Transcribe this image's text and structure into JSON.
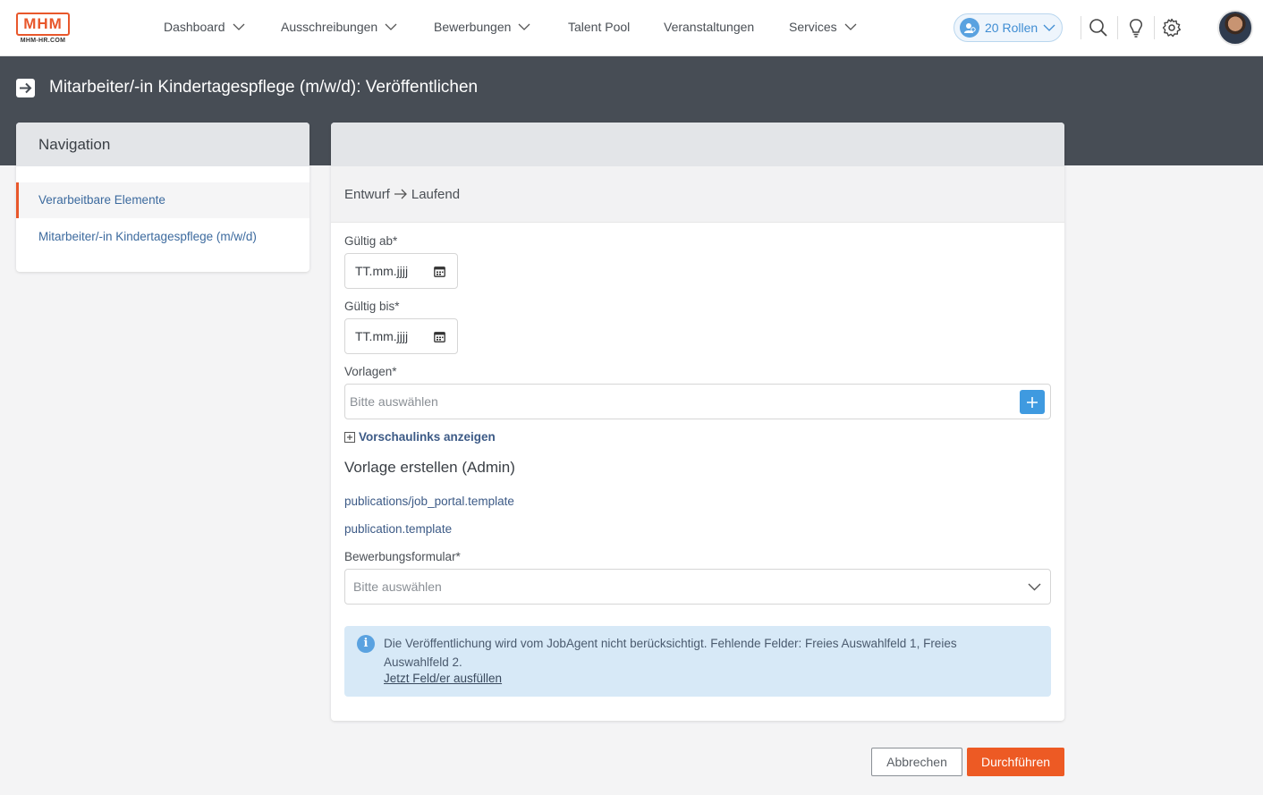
{
  "logo": {
    "text": "MHM",
    "subtext": "MHM-HR.COM"
  },
  "nav": {
    "items": [
      {
        "label": "Dashboard",
        "dropdown": true
      },
      {
        "label": "Ausschreibungen",
        "dropdown": true
      },
      {
        "label": "Bewerbungen",
        "dropdown": true
      },
      {
        "label": "Talent Pool",
        "dropdown": false
      },
      {
        "label": "Veranstaltungen",
        "dropdown": false
      },
      {
        "label": "Services",
        "dropdown": true
      }
    ],
    "roles_label": "20 Rollen"
  },
  "page": {
    "title": "Mitarbeiter/-in Kindertagespflege (m/w/d): Veröffentlichen"
  },
  "sidebar": {
    "heading": "Navigation",
    "items": [
      {
        "label": "Verarbeitbare Elemente",
        "active": true
      },
      {
        "label": "Mitarbeiter/-in Kindertagespflege (m/w/d)",
        "active": false
      }
    ]
  },
  "form": {
    "status_from": "Entwurf",
    "status_to": "Laufend",
    "valid_from_label": "Gültig ab*",
    "valid_from_value": "TT.mm.jjjj",
    "valid_to_label": "Gültig bis*",
    "valid_to_value": "TT.mm.jjjj",
    "templates_label": "Vorlagen*",
    "templates_placeholder": "Bitte auswählen",
    "preview_links_label": "Vorschaulinks anzeigen",
    "create_template_heading": "Vorlage erstellen (Admin)",
    "template_links": [
      "publications/job_portal.template",
      "publication.template"
    ],
    "application_form_label": "Bewerbungsformular*",
    "application_form_placeholder": "Bitte auswählen",
    "info_message": "Die Veröffentlichung wird vom JobAgent nicht berücksichtigt. Fehlende Felder: Freies Auswahlfeld 1, Freies Auswahlfeld 2.",
    "info_link": "Jetzt Feld/er ausfüllen"
  },
  "actions": {
    "cancel_label": "Abbrechen",
    "run_label": "Durchführen"
  },
  "colors": {
    "brand": "#e8572b",
    "primary_button": "#ed5a24",
    "header_band": "#474d55",
    "link": "#3c5a86",
    "info_bg": "#d7e9f7",
    "accent_blue": "#3f9ae0"
  },
  "icons": [
    "chevron-down-icon",
    "users-icon",
    "search-icon",
    "lightbulb-icon",
    "gear-icon",
    "arrow-right-icon",
    "calendar-icon",
    "plus-icon",
    "info-icon"
  ]
}
